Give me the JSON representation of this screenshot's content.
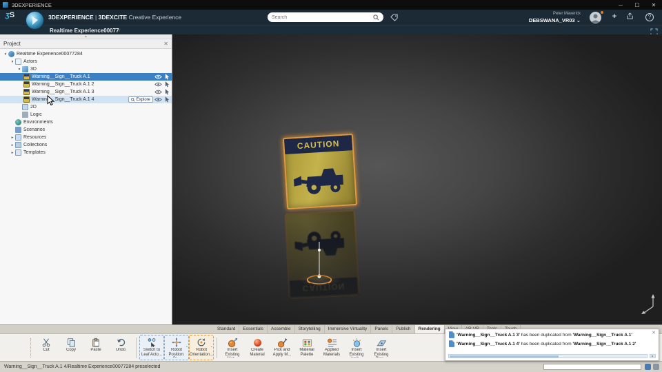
{
  "glyphs": {
    "minimize": "─",
    "maximize": "☐",
    "close": "✕",
    "chevron_down": "⌄",
    "plus": "+",
    "help": "?",
    "collapse_up": "▴",
    "expand_open": "▾",
    "expand_closed": "▸",
    "scroll_right": "▸"
  },
  "colors": {
    "selection_blue": "#3c80c4",
    "highlight_orange": "#e09a40",
    "sign_yellow": "#c4b24c",
    "sign_navy": "#1e2746",
    "header_navy": "#1b2a35"
  },
  "window": {
    "title": "3DEXPERIENCE"
  },
  "header": {
    "brand": "3DEXPERIENCE",
    "brand_sep": "|",
    "app": "3DEXCITE",
    "app_tag": "Creative Experience",
    "search_placeholder": "Search",
    "user_name": "Peter Maverick",
    "tenant": "DEBSWANA_VR03"
  },
  "breadcrumb": {
    "title": "Realtime Experience00077"
  },
  "project_panel": {
    "title": "Project",
    "explore_label": "Explore",
    "tree": [
      {
        "label": "Realtime Experience00077284"
      },
      {
        "label": "Actors"
      },
      {
        "label": "3D"
      },
      {
        "label": "Warning__Sign__Truck A.1",
        "selected": true
      },
      {
        "label": "Warning__Sign__Truck A.1 2"
      },
      {
        "label": "Warning__Sign__Truck A.1 3"
      },
      {
        "label": "Warning__Sign__Truck A.1 4",
        "hovered": true
      },
      {
        "label": "2D"
      },
      {
        "label": "Logic"
      },
      {
        "label": "Environments"
      },
      {
        "label": "Scenarios"
      },
      {
        "label": "Resources"
      },
      {
        "label": "Collections"
      },
      {
        "label": "Templates"
      }
    ]
  },
  "viewport": {
    "sign_text": "CAUTION"
  },
  "ribbon": {
    "tabs": [
      {
        "label": "Standard"
      },
      {
        "label": "Essentials"
      },
      {
        "label": "Assemble"
      },
      {
        "label": "Storytelling"
      },
      {
        "label": "Immersive Virtuality"
      },
      {
        "label": "Panels"
      },
      {
        "label": "Publish"
      },
      {
        "label": "Rendering",
        "selected": true
      },
      {
        "label": "View"
      },
      {
        "label": "AR-VR"
      },
      {
        "label": "Tools"
      },
      {
        "label": "Touch"
      }
    ]
  },
  "toolbar": {
    "items": [
      {
        "label": "Cut"
      },
      {
        "label": "Copy"
      },
      {
        "label": "Paste"
      },
      {
        "label": "Undo"
      },
      {
        "label": "Switch to Leaf Acto..."
      },
      {
        "label": "Robot Position: Or..."
      },
      {
        "label": "Robot Orientation..."
      },
      {
        "label": "Insert Existing Mat..."
      },
      {
        "label": "Create Material"
      },
      {
        "label": "Pick and Apply M..."
      },
      {
        "label": "Material Palette"
      },
      {
        "label": "Applied Materials"
      },
      {
        "label": "Insert Existing Amb..."
      },
      {
        "label": "Insert Existing Plan..."
      }
    ]
  },
  "notifications": {
    "items": [
      {
        "subject": "'Warning__Sign__Truck A.1 3'",
        "middle": " has been duplicated from ",
        "source": "'Warning__Sign__Truck A.1'"
      },
      {
        "subject": "'Warning__Sign__Truck A.1 4'",
        "middle": " has been duplicated from ",
        "source": "'Warning__Sign__Truck A.1 2'"
      }
    ]
  },
  "statusbar": {
    "message": "Warning__Sign__Truck A.1 4/Realtime Experience00077284 preselected"
  }
}
